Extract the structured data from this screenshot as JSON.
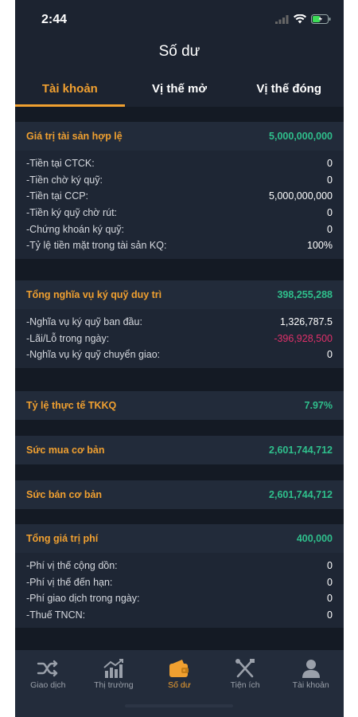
{
  "status": {
    "time": "2:44"
  },
  "header": {
    "title": "Số dư"
  },
  "tabs": [
    {
      "label": "Tài khoản",
      "active": true
    },
    {
      "label": "Vị thế mở",
      "active": false
    },
    {
      "label": "Vị thế đóng",
      "active": false
    }
  ],
  "sections": {
    "assets": {
      "label": "Giá trị tài sản hợp lệ",
      "value": "5,000,000,000",
      "rows": [
        {
          "label": "-Tiền tại CTCK:",
          "value": "0"
        },
        {
          "label": "-Tiền chờ ký quỹ:",
          "value": "0"
        },
        {
          "label": "-Tiền tại CCP:",
          "value": "5,000,000,000"
        },
        {
          "label": "-Tiền ký quỹ chờ rút:",
          "value": "0"
        },
        {
          "label": "-Chứng khoán ký quỹ:",
          "value": "0"
        },
        {
          "label": "-Tỷ lệ tiền mặt trong tài sản KQ:",
          "value": "100%"
        }
      ]
    },
    "margin": {
      "label": "Tổng nghĩa vụ ký quỹ duy trì",
      "value": "398,255,288",
      "rows": [
        {
          "label": "-Nghĩa vụ ký quỹ ban đầu:",
          "value": "1,326,787.5"
        },
        {
          "label": "-Lãi/Lỗ trong ngày:",
          "value": "-396,928,500"
        },
        {
          "label": "-Nghĩa vụ ký quỹ chuyển giao:",
          "value": "0"
        }
      ]
    },
    "ratio": {
      "label": "Tỷ lệ thực tế TKKQ",
      "value": "7.97%"
    },
    "buy_power": {
      "label": "Sức mua cơ bản",
      "value": "2,601,744,712"
    },
    "sell_power": {
      "label": "Sức bán cơ bản",
      "value": "2,601,744,712"
    },
    "fees": {
      "label": "Tổng giá trị phí",
      "value": "400,000",
      "rows": [
        {
          "label": "-Phí vị thế cộng dồn:",
          "value": "0"
        },
        {
          "label": "-Phí vị thế đến hạn:",
          "value": "0"
        },
        {
          "label": "-Phí giao dịch trong ngày:",
          "value": "0"
        },
        {
          "label": "-Thuế TNCN:",
          "value": "0"
        }
      ]
    }
  },
  "colors": {
    "accent": "#f0a030",
    "positive": "#2fbf8c",
    "negative": "#e0306a",
    "background": "#1c2330"
  },
  "bottom_nav": [
    {
      "label": "Giao dịch",
      "icon": "shuffle-icon",
      "active": false
    },
    {
      "label": "Thị trường",
      "icon": "chart-icon",
      "active": false
    },
    {
      "label": "Số dư",
      "icon": "wallet-icon",
      "active": true
    },
    {
      "label": "Tiện ích",
      "icon": "tools-icon",
      "active": false
    },
    {
      "label": "Tài khoản",
      "icon": "user-icon",
      "active": false
    }
  ]
}
